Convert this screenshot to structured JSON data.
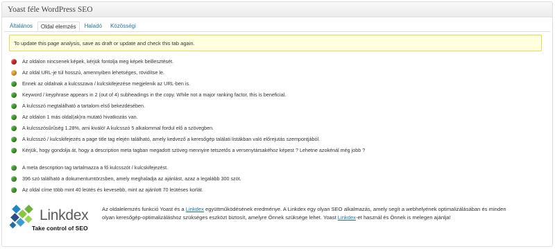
{
  "metabox": {
    "title": "Yoast féle WordPress SEO"
  },
  "tabs": [
    {
      "label": "Általános",
      "active": false
    },
    {
      "label": "Oldal elemzés",
      "active": true
    },
    {
      "label": "Haladó",
      "active": false
    },
    {
      "label": "Közösségi",
      "active": false
    }
  ],
  "notice": {
    "text": "To update this page analysis, save as draft or update and check this tab again."
  },
  "results": [
    {
      "status": "red",
      "text": "Az oldalon nincsenek képek, kérjük fontolja meg képek beillesztését."
    },
    {
      "status": "orange",
      "text": "Az oldal URL-je túl hosszú, amennyiben lehetséges, rövidítse le."
    },
    {
      "status": "green",
      "text": "Ennek az oldalnak a kulcsszava / kulcskifejezése megjelenik az URL-ben is."
    },
    {
      "status": "green",
      "text": "Keyword / keyphrase appears in 2 (out of 4) subheadings in the copy. While not a major ranking factor, this is beneficial."
    },
    {
      "status": "green",
      "text": "A kulcsszó megtalálható a tartalom első bekezdésében."
    },
    {
      "status": "green",
      "text": "Az oldalon 1 más oldal(ak)ra mutató hivatkozás van."
    },
    {
      "status": "green",
      "text": "A kulcsszósűrűség 1.28%, ami kiváló! A kulcsszó 5 alkalommal fordul elő a szövegben."
    },
    {
      "status": "green",
      "text": "A kulcsszó / kulcskifejezés a page title tag elején található, amely kedvező a keresőgép találati listákban való előrejutás szempontjából."
    },
    {
      "status": "green",
      "text": "Kérjük, hogy gondolja át, hogy a description meta tagban megadott szöveg mennyire tetszetős a versenytársakéhoz képest ? Lehetne azokénál még jobb ?"
    },
    {
      "status": "green",
      "text": "A meta description tag tartalmazza a fő kulcsszót / kulcskifejezést."
    },
    {
      "status": "green",
      "text": "396 szó található a dokumentumtörzsben, amely meghaladja az ajánlást, azaz a legalább 300 szót."
    },
    {
      "status": "green",
      "text": "Az oldal címe több mint 40 leütés és kevesebb, mint az ajánlott 70 leütéses korlát."
    }
  ],
  "partner": {
    "logo_name": "Linkdex",
    "logo_tagline": "Take control of SEO",
    "line1_before": "Az oldalelemzés funkció Yoast és a ",
    "line1_link": "Linkdex",
    "line1_after": " együttműködésének eredménye. A Linkdex egy olyan SEO alkalmazás, amely segít a webhelyének optimalizálásában és minden",
    "line2_before": "olyan keresőgép-optimalizáláshoz szükséges eszközt biztosít, amelyre Önnek szüksége lehet. Yoast ",
    "line2_link": "Linkdex",
    "line2_after": "-et használ és Önnek is melegen ajánlja!"
  },
  "colors": {
    "link": "#21759b",
    "notice_bg": "#ffffe0",
    "notice_border": "#e6db55",
    "status_red": "#d9251f",
    "status_orange": "#e7a62c",
    "status_green": "#3fa12c"
  }
}
